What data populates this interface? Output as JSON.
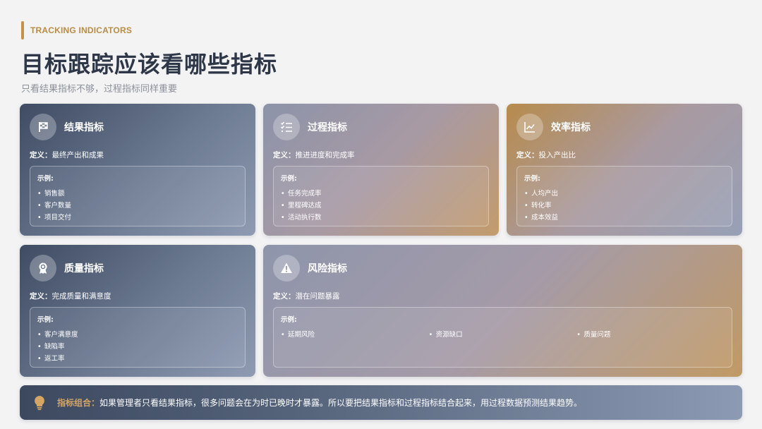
{
  "header": {
    "eyebrow": "TRACKING INDICATORS",
    "title": "目标跟踪应该看哪些指标",
    "subtitle": "只看结果指标不够，过程指标同样重要"
  },
  "labels": {
    "definition_prefix": "定义：",
    "examples_label": "示例:"
  },
  "cards": [
    {
      "icon": "flag-icon",
      "title": "结果指标",
      "definition": "最终产出和成果",
      "examples": [
        "销售额",
        "客户数量",
        "项目交付"
      ]
    },
    {
      "icon": "checklist-icon",
      "title": "过程指标",
      "definition": "推进进度和完成率",
      "examples": [
        "任务完成率",
        "里程碑达成",
        "活动执行数"
      ]
    },
    {
      "icon": "line-chart-icon",
      "title": "效率指标",
      "definition": "投入产出比",
      "examples": [
        "人均产出",
        "转化率",
        "成本效益"
      ]
    },
    {
      "icon": "award-icon",
      "title": "质量指标",
      "definition": "完成质量和满意度",
      "examples": [
        "客户满意度",
        "缺陷率",
        "返工率"
      ]
    },
    {
      "icon": "warning-icon",
      "title": "风险指标",
      "definition": "潜在问题暴露",
      "examples": [
        "延期风险",
        "资源缺口",
        "质量问题"
      ]
    }
  ],
  "footer": {
    "icon": "lightbulb-icon",
    "lead": "指标组合：",
    "text": "如果管理者只看结果指标，很多问题会在为时已晚时才暴露。所以要把结果指标和过程指标结合起来，用过程数据预测结果趋势。"
  },
  "colors": {
    "accent": "#c2944a",
    "title": "#2e3748",
    "subtitle": "#8b909a",
    "navy": "#3f4c63"
  }
}
